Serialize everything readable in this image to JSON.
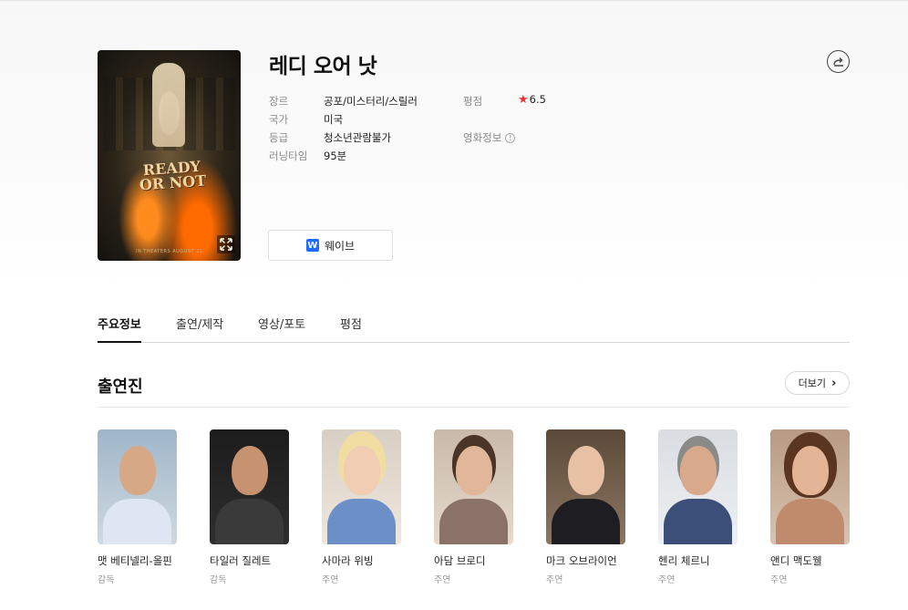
{
  "movie": {
    "title": "레디 오어 낫",
    "poster_title_line1": "READY",
    "poster_title_line2": "OR NOT",
    "poster_tagline": "IN THEATERS AUGUST 21"
  },
  "info": {
    "genre_label": "장르",
    "genre_value": "공포/미스터리/스릴러",
    "country_label": "국가",
    "country_value": "미국",
    "grade_label": "등급",
    "grade_value": "청소년관람불가",
    "runtime_label": "러닝타임",
    "runtime_value": "95분",
    "rating_label": "평점",
    "rating_value": "6.5",
    "movie_info_label": "영화정보"
  },
  "stream": {
    "label": "웨이브",
    "logo_letter": "W"
  },
  "tabs": [
    {
      "label": "주요정보"
    },
    {
      "label": "출연/제작"
    },
    {
      "label": "영상/포토"
    },
    {
      "label": "평점"
    }
  ],
  "cast_section": {
    "title": "출연진",
    "more_label": "더보기"
  },
  "cast": [
    {
      "name": "맷 베티넬리-올핀",
      "role": "감독"
    },
    {
      "name": "타일러 질레트",
      "role": "감독"
    },
    {
      "name": "사마라 위빙",
      "role": "주연"
    },
    {
      "name": "아담 브로디",
      "role": "주연"
    },
    {
      "name": "마크 오브라이언",
      "role": "주연"
    },
    {
      "name": "헨리 체르니",
      "role": "주연"
    },
    {
      "name": "앤디 맥도웰",
      "role": "주연"
    }
  ],
  "colors": {
    "accent_star": "#ff2b2b",
    "wavve_blue": "#1f6bff",
    "tab_active": "#111111"
  }
}
